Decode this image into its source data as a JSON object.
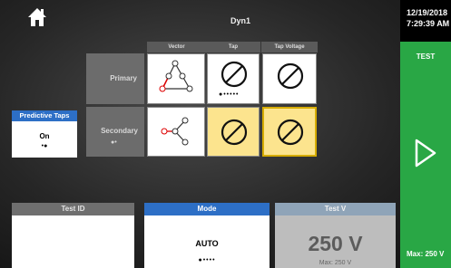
{
  "header": {
    "title": "Dyn1",
    "date": "12/19/2018",
    "time": "7:29:39 AM"
  },
  "test_panel": {
    "label": "TEST",
    "max_label": "Max: 250 V",
    "color": "#29a745"
  },
  "grid": {
    "columns": [
      "Vector",
      "Tap",
      "Tap Voltage"
    ],
    "rows": [
      {
        "label": "Primary",
        "tap_position_dots": "●•••••"
      },
      {
        "label": "Secondary",
        "page_dots": "●•"
      }
    ]
  },
  "predictive_taps": {
    "label": "Predictive Taps",
    "value": "On",
    "page_dots": "•●"
  },
  "test_id": {
    "label": "Test ID",
    "value": ""
  },
  "mode": {
    "label": "Mode",
    "value": "AUTO",
    "page_dots": "●••••"
  },
  "test_voltage": {
    "label": "Test V",
    "value": "250 V",
    "max": "Max: 250 V"
  },
  "icons": [
    "home-icon",
    "play-icon",
    "delta-vector-icon",
    "wye-vector-icon",
    "disabled-icon"
  ],
  "colors": {
    "accent_blue": "#2d6fc6",
    "highlight_yellow": "#fce48e",
    "test_green": "#29a745"
  }
}
